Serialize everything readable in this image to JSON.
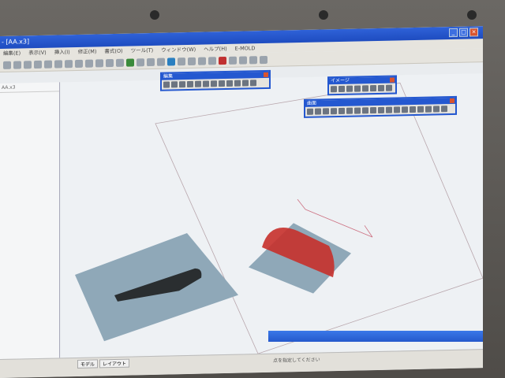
{
  "window": {
    "title": "- [AA.x3]"
  },
  "menu": [
    "編集(E)",
    "表示(V)",
    "挿入(I)",
    "修正(M)",
    "書式(O)",
    "ツール(T)",
    "ウィンドウ(W)",
    "ヘルプ(H)",
    "E-MOLD"
  ],
  "left_panel": {
    "header": "AA.x3"
  },
  "panels": {
    "edit": "編集",
    "image": "イメージ",
    "surface": "曲面"
  },
  "status": {
    "tabs": [
      "モデル",
      "レイアウト"
    ],
    "message": "点を指定してください"
  },
  "colors": {
    "titlebar": "#2458d0",
    "model": "#d8302a",
    "plane": "#8fa8b8"
  }
}
